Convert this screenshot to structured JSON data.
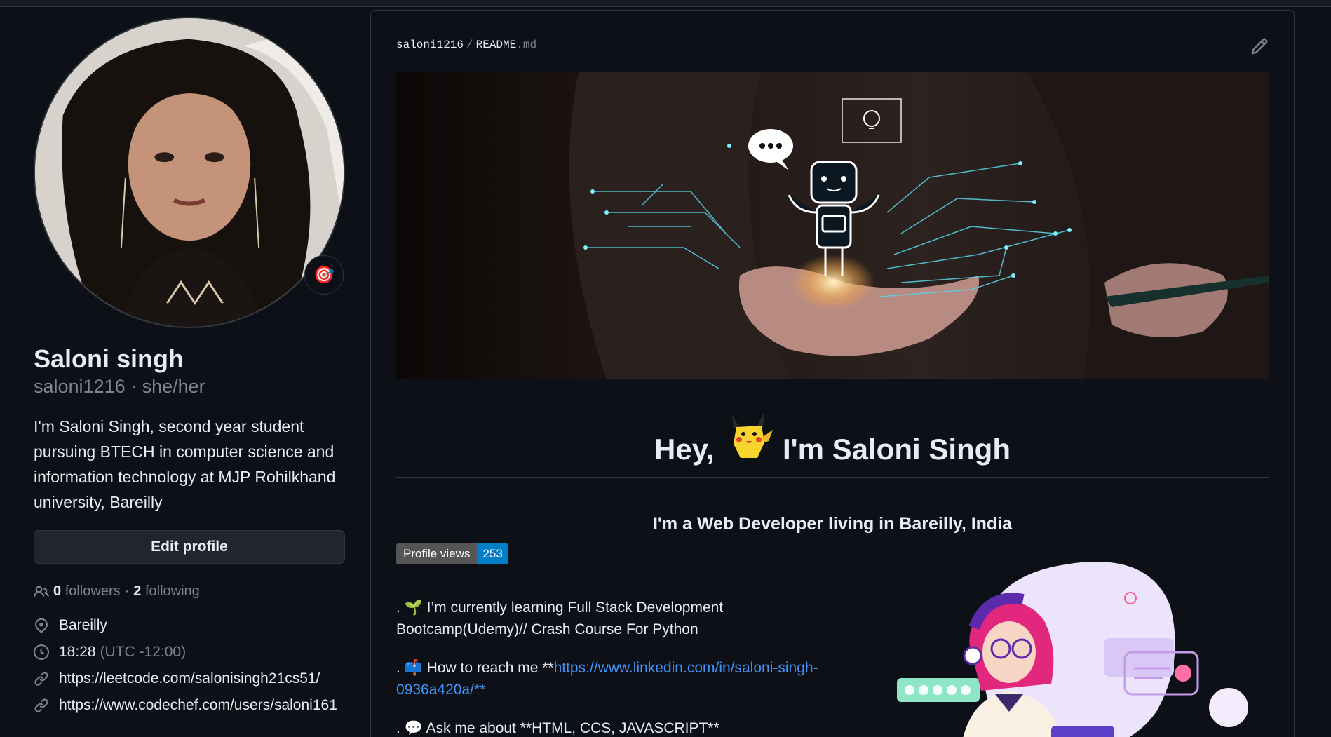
{
  "sidebar": {
    "name": "Saloni singh",
    "login": "saloni1216 · she/her",
    "bio": "I'm Saloni Singh, second year student pursuing BTECH in computer science and information technology at MJP Rohilkhand university, Bareilly",
    "status_emoji": "🎯",
    "edit_profile_label": "Edit profile",
    "followers_count": "0",
    "followers_label": "followers",
    "following_count": "2",
    "following_label": "following",
    "separator": "·",
    "location": "Bareilly",
    "local_time": "18:28",
    "timezone": "(UTC -12:00)",
    "links": [
      "https://leetcode.com/salonisingh21cs51/",
      "https://www.codechef.com/users/saloni161"
    ]
  },
  "readme": {
    "owner": "saloni1216",
    "path_sep": "/",
    "file_name": "README",
    "file_ext": ".md",
    "heading_prefix": "Hey,",
    "heading_suffix": "I'm Saloni Singh",
    "subtitle": "I'm a Web Developer living in Bareilly, India",
    "views_label": "Profile views",
    "views_count": "253",
    "line1": ". 🌱 I’m currently learning Full Stack Development Bootcamp(Udemy)// Crash Course For Python",
    "line2_prefix": ". 📫 How to reach me **",
    "line2_link": "https://www.linkedin.com/in/saloni-singh-0936a420a/**",
    "line3": ". 💬 Ask me about **HTML, CCS, JAVASCRIPT**"
  },
  "icons": {
    "followers": "people-icon",
    "location": "location-pin-icon",
    "time": "clock-icon",
    "link": "link-icon",
    "edit": "pencil-icon"
  },
  "colors": {
    "background": "#0d1117",
    "border": "#30363d",
    "muted": "#7d8590",
    "link": "#4493f8",
    "badge_count": "#007ec6"
  }
}
